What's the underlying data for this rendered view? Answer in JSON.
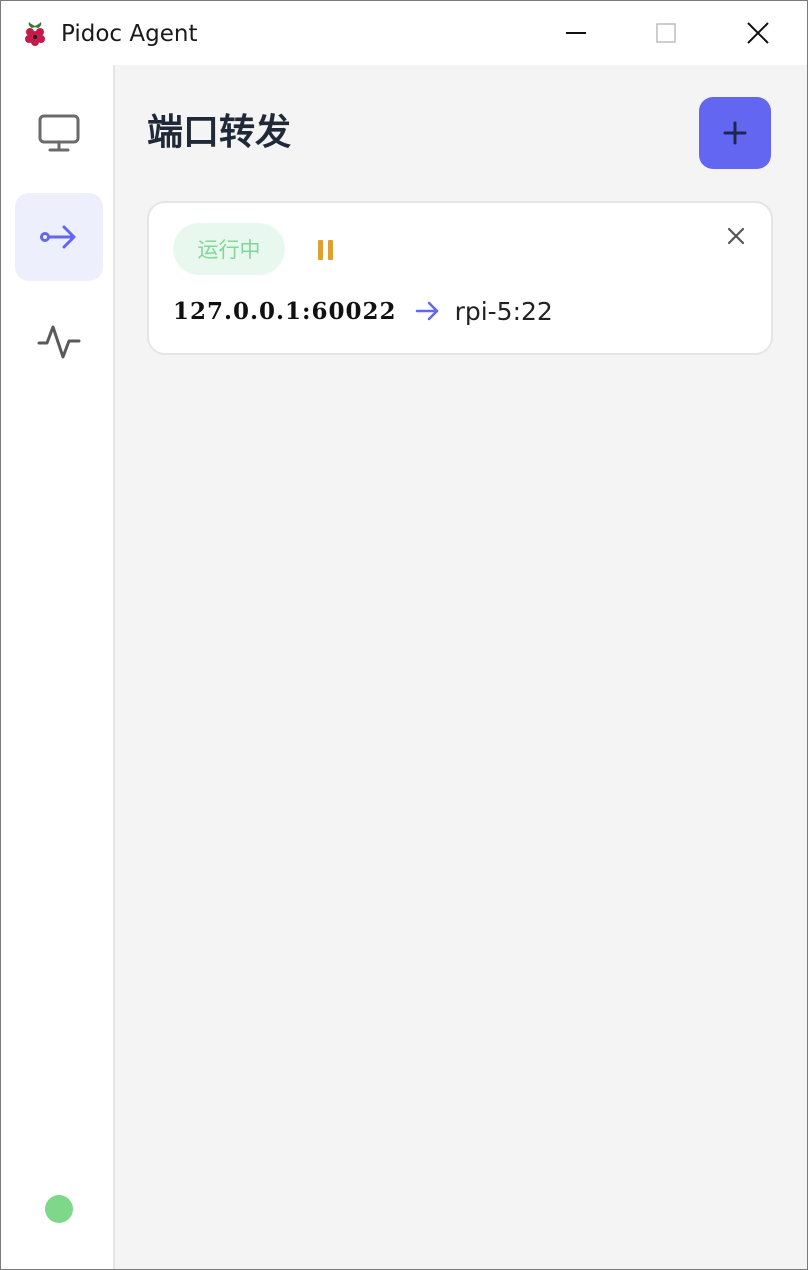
{
  "window": {
    "title": "Pidoc Agent"
  },
  "sidebar": {
    "items": [
      {
        "icon": "monitor-icon",
        "active": false
      },
      {
        "icon": "port-forward-icon",
        "active": true
      },
      {
        "icon": "activity-icon",
        "active": false
      }
    ],
    "status_color": "#7dd88a"
  },
  "main": {
    "title": "端口转发",
    "add_icon": "plus-icon",
    "forwards": [
      {
        "status": "运行中",
        "local": "127.0.0.1:60022",
        "remote": "rpi-5:22"
      }
    ]
  },
  "colors": {
    "accent": "#6366f1",
    "running_badge_bg": "#e9f8ee",
    "running_badge_text": "#7fd899",
    "pause": "#e0a030"
  }
}
